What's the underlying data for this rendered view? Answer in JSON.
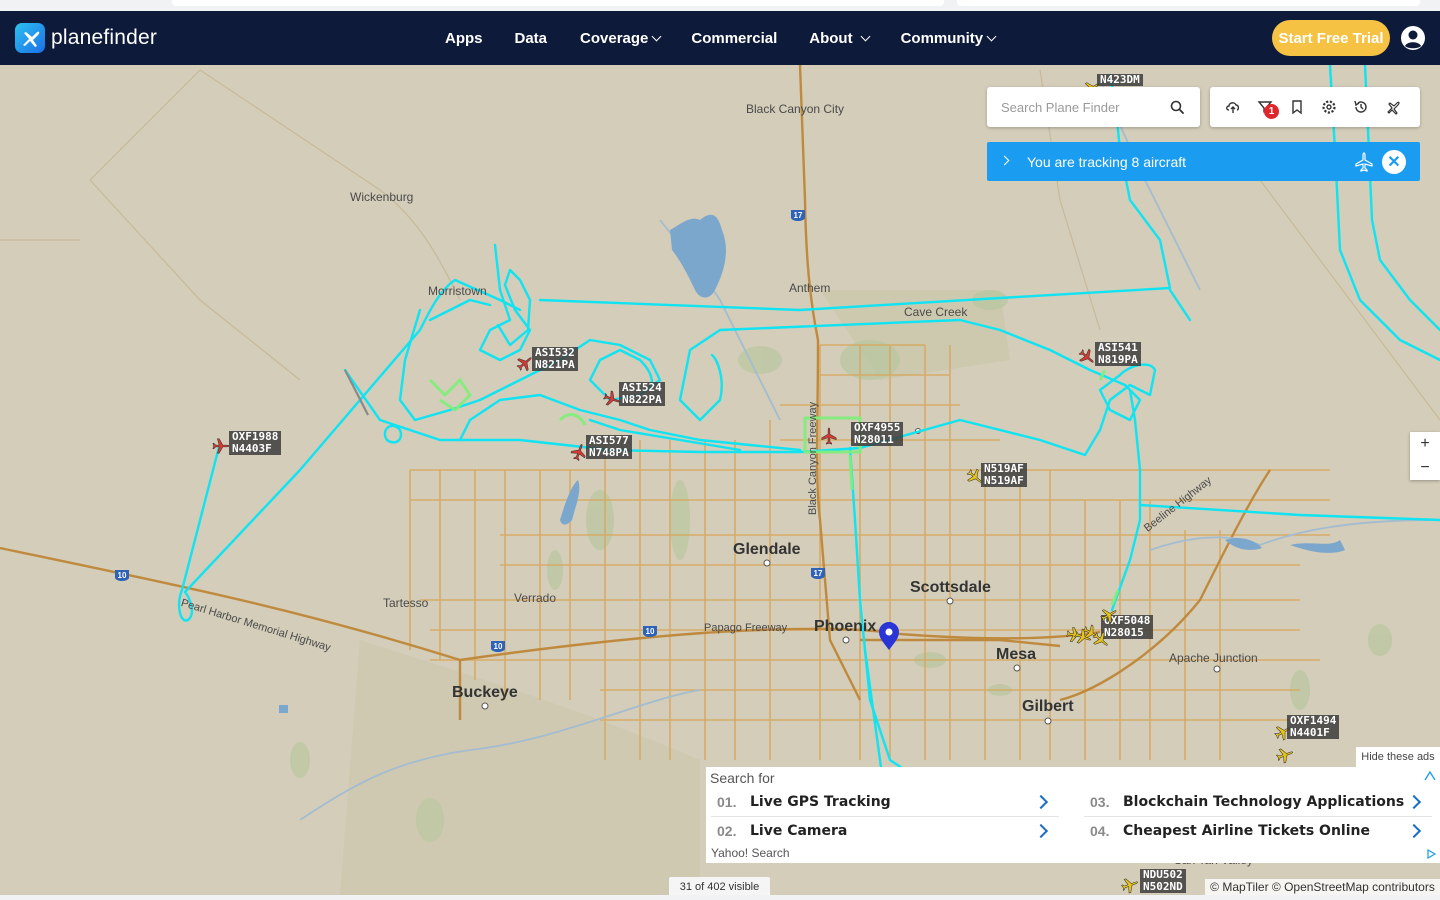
{
  "app": {
    "brand": "planefinder"
  },
  "nav": {
    "items": [
      {
        "label": "Apps",
        "dropdown": false
      },
      {
        "label": "Data",
        "dropdown": false
      },
      {
        "label": "Coverage",
        "dropdown": true
      },
      {
        "label": "Commercial",
        "dropdown": false
      },
      {
        "label": "About",
        "dropdown": true
      },
      {
        "label": "Community",
        "dropdown": true
      }
    ],
    "cta": "Start Free Trial"
  },
  "search": {
    "placeholder": "Search Plane Finder"
  },
  "toolbar": {
    "alert_count": "1",
    "icons": [
      "cloud-upload-icon",
      "filter-icon",
      "bookmark-icon",
      "settings-icon",
      "history-icon",
      "flights-icon"
    ]
  },
  "tracking": {
    "text": "You are tracking 8 aircraft"
  },
  "zoom": {
    "in": "+",
    "out": "−"
  },
  "places": [
    {
      "name": "Black Canyon City",
      "size": "small"
    },
    {
      "name": "Wickenburg",
      "size": "small"
    },
    {
      "name": "Morristown",
      "size": "small"
    },
    {
      "name": "Anthem",
      "size": "small"
    },
    {
      "name": "Cave Creek",
      "size": "small"
    },
    {
      "name": "Glendale",
      "size": "big"
    },
    {
      "name": "Scottsdale",
      "size": "big"
    },
    {
      "name": "Phoenix",
      "size": "big"
    },
    {
      "name": "Mesa",
      "size": "big"
    },
    {
      "name": "Gilbert",
      "size": "big"
    },
    {
      "name": "Buckeye",
      "size": "big"
    },
    {
      "name": "Tartesso",
      "size": "small"
    },
    {
      "name": "Verrado",
      "size": "small"
    },
    {
      "name": "Apache Junction",
      "size": "small"
    },
    {
      "name": "Papago Freeway",
      "size": "small"
    },
    {
      "name": "Pearl Harbor Memorial Highway",
      "size": "small"
    },
    {
      "name": "Beeline Highway",
      "size": "small"
    },
    {
      "name": "Black Canyon Freeway",
      "size": "small"
    },
    {
      "name": "San Tan Valley",
      "size": "small"
    }
  ],
  "aircraft": [
    {
      "callsign": "N423DM",
      "reg": "",
      "color": "#e8c417"
    },
    {
      "callsign": "ASI532",
      "reg": "N821PA",
      "color": "#d63a32"
    },
    {
      "callsign": "ASI524",
      "reg": "N822PA",
      "color": "#d63a32"
    },
    {
      "callsign": "ASI577",
      "reg": "N748PA",
      "color": "#d63a32"
    },
    {
      "callsign": "OXF1988",
      "reg": "N4403F",
      "color": "#d63a32"
    },
    {
      "callsign": "OXF4955",
      "reg": "N28011",
      "color": "#d63a32"
    },
    {
      "callsign": "ASI541",
      "reg": "N819PA",
      "color": "#d63a32"
    },
    {
      "callsign": "N519AF",
      "reg": "N519AF",
      "color": "#e8c417"
    },
    {
      "callsign": "OXF5048",
      "reg": "N28015",
      "color": "#e8c417"
    },
    {
      "callsign": "OXF1494",
      "reg": "N4401F",
      "color": "#e8c417"
    },
    {
      "callsign": "NDU502",
      "reg": "N502ND",
      "color": "#e8c417"
    }
  ],
  "ad": {
    "heading": "Search for",
    "items": [
      {
        "num": "01.",
        "label": "Live GPS Tracking"
      },
      {
        "num": "02.",
        "label": "Live Camera"
      },
      {
        "num": "03.",
        "label": "Blockchain Technology Applications"
      },
      {
        "num": "04.",
        "label": "Cheapest Airline Tickets Online"
      }
    ],
    "footer": "Yahoo! Search",
    "hide": "Hide these ads"
  },
  "status": {
    "visible": "31 of 402 visible",
    "attribution": "© MapTiler © OpenStreetMap contributors"
  },
  "colors": {
    "nav": "#0d1a3a",
    "track": "#00e5ff",
    "accent": "#1a9cf0",
    "cta": "#f6c243"
  }
}
